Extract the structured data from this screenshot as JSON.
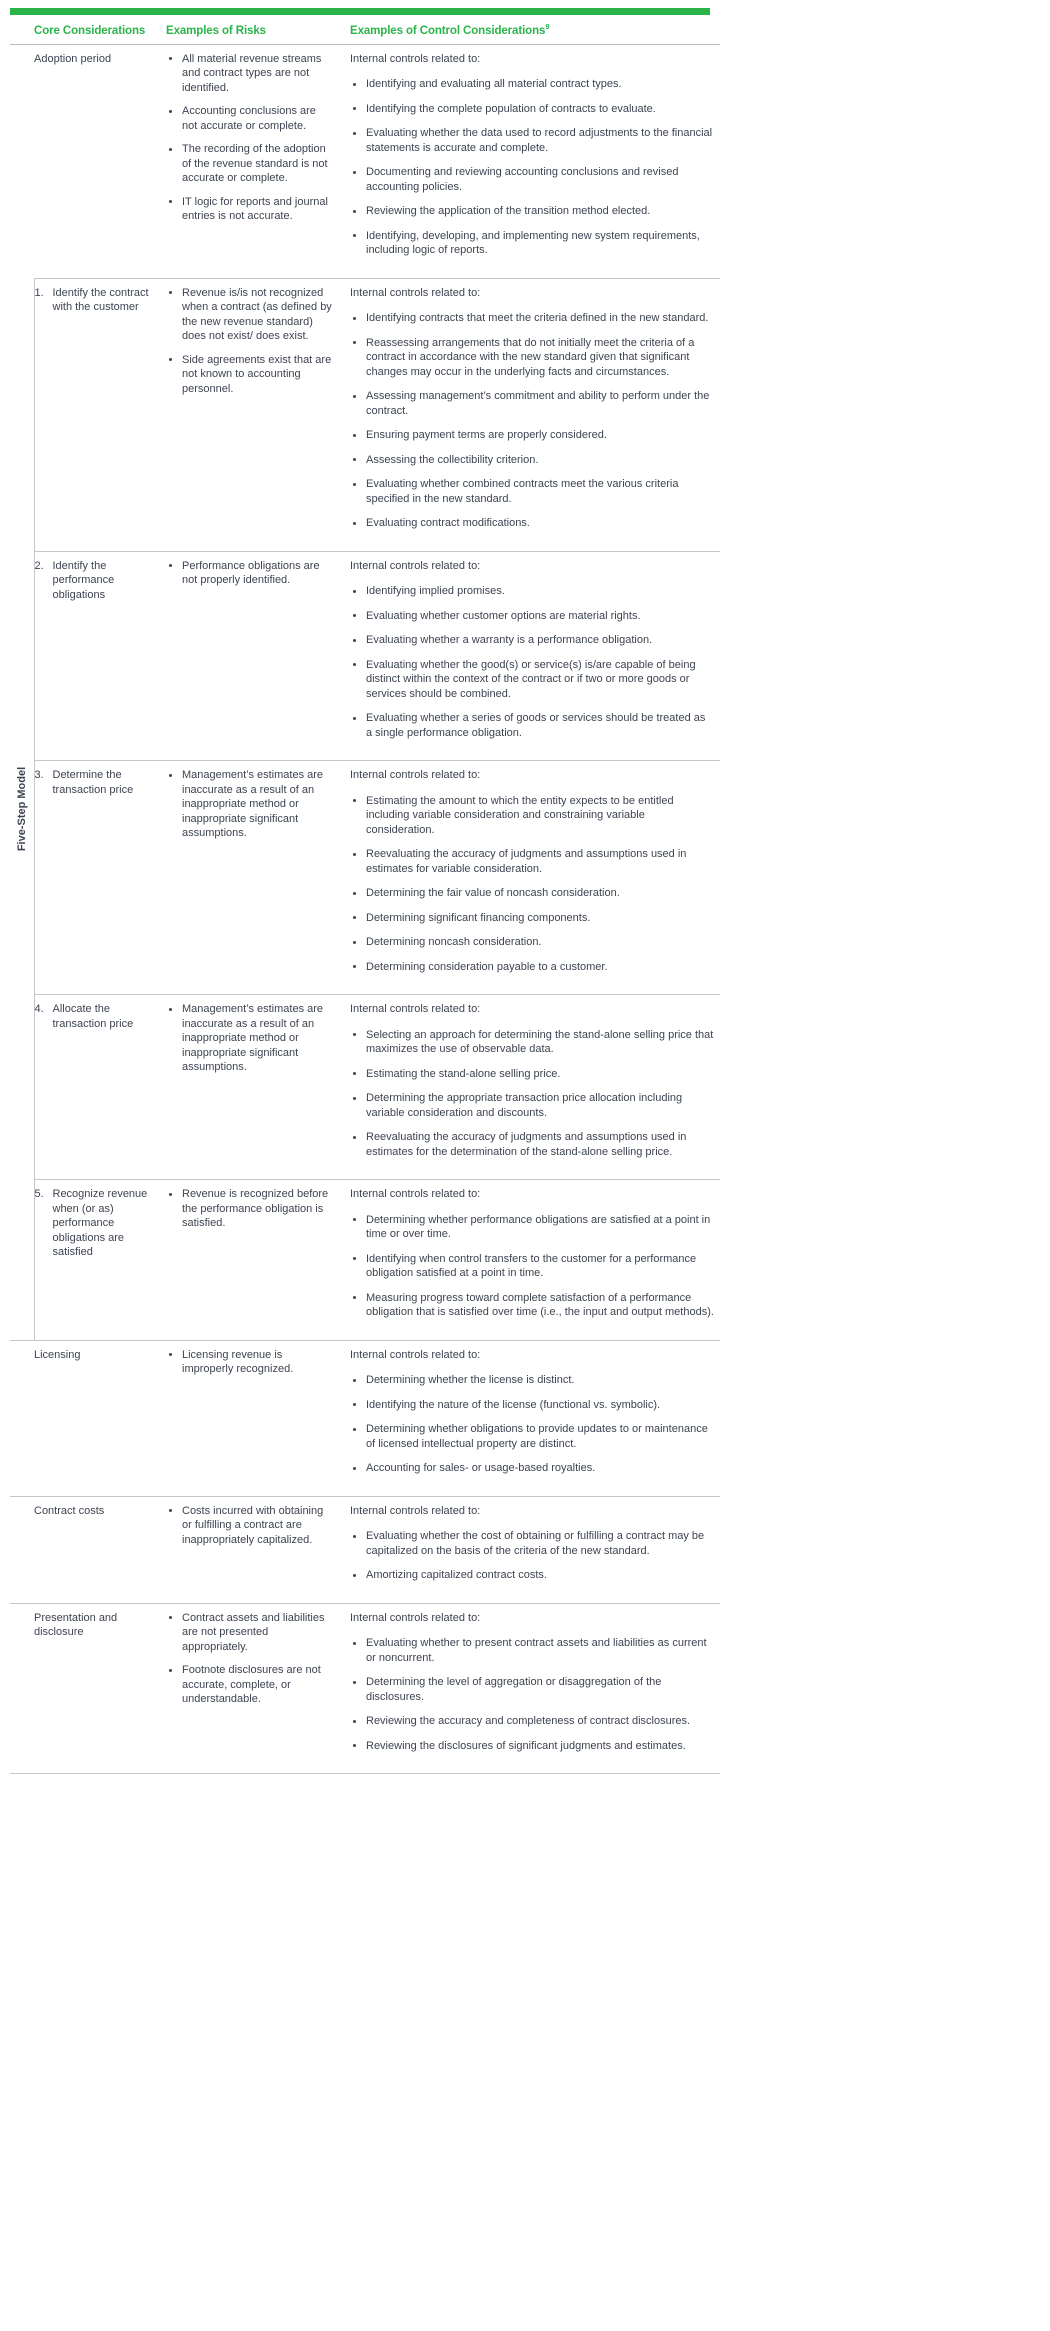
{
  "accent_color": "#2cb34a",
  "text_color": "#3d4451",
  "rule_color": "#c3c6cb",
  "header": {
    "core": "Core Considerations",
    "risks": "Examples of Risks",
    "controls": "Examples of Control Considerations",
    "controls_footnote": "9"
  },
  "side_label": "Five-Step Model",
  "lead_text": "Internal controls related to:",
  "rows": [
    {
      "core": "Adoption period",
      "number": "",
      "risks": [
        "All material revenue streams and contract types are not identified.",
        "Accounting conclusions are not accurate or complete.",
        "The recording of the adoption of the revenue standard is not accurate or complete.",
        "IT logic for reports and journal entries is not accurate."
      ],
      "controls_lead": "Internal controls related to:",
      "controls": [
        "Identifying and evaluating all material contract types.",
        "Identifying the complete population of contracts to evaluate.",
        "Evaluating whether the data used to record adjustments to the financial statements is accurate and complete.",
        "Documenting and reviewing accounting conclusions and revised accounting policies.",
        "Reviewing the application of the transition method elected.",
        "Identifying, developing, and implementing new system requirements, including logic of reports."
      ]
    },
    {
      "core": "Identify the contract with the customer",
      "number": "1.",
      "in_group": true,
      "risks": [
        "Revenue is/is not recognized when a contract (as defined by the new revenue standard) does not exist/ does exist.",
        "Side agreements exist that are not known to accounting personnel."
      ],
      "controls_lead": "Internal controls related to:",
      "controls": [
        "Identifying contracts that meet the criteria defined in the new standard.",
        "Reassessing arrangements that do not initially meet the criteria of a contract in accordance with the new standard given that significant changes may occur in the underlying facts and circumstances.",
        "Assessing management’s commitment and ability to perform under the contract.",
        "Ensuring payment terms are properly considered.",
        "Assessing the collectibility criterion.",
        "Evaluating whether combined contracts meet the various criteria specified in the new standard.",
        "Evaluating contract modifications."
      ]
    },
    {
      "core": "Identify the performance obligations",
      "number": "2.",
      "in_group": true,
      "risks": [
        "Performance obligations are not properly identified."
      ],
      "controls_lead": "Internal controls related to:",
      "controls": [
        "Identifying implied promises.",
        "Evaluating whether customer options are material rights.",
        "Evaluating whether a warranty is a performance obligation.",
        "Evaluating whether the good(s) or service(s) is/are capable of being distinct within the context of the contract or if two or more goods or services should be combined.",
        "Evaluating whether a series of goods or services should be treated as a single performance obligation."
      ]
    },
    {
      "core": "Determine the transaction price",
      "number": "3.",
      "in_group": true,
      "risks": [
        "Management’s estimates are inaccurate as a result of an inappropriate method or inappropriate significant assumptions."
      ],
      "controls_lead": "Internal controls related to:",
      "controls": [
        "Estimating the amount to which the entity expects to be entitled including variable consideration and constraining variable consideration.",
        "Reevaluating the accuracy of judgments and assumptions used in estimates for variable consideration.",
        "Determining the fair value of noncash consideration.",
        "Determining significant financing components.",
        "Determining noncash consideration.",
        "Determining consideration payable to a customer."
      ]
    },
    {
      "core": "Allocate the transaction price",
      "number": "4.",
      "in_group": true,
      "risks": [
        "Management’s estimates are inaccurate as a result of an inappropriate method or inappropriate significant assumptions."
      ],
      "controls_lead": "Internal controls related to:",
      "controls": [
        "Selecting an approach for determining the stand-alone selling price that maximizes the use of observable data.",
        "Estimating the stand-alone selling price.",
        "Determining the appropriate transaction price allocation including variable consideration and discounts.",
        "Reevaluating the accuracy of judgments and assumptions used in estimates for the determination of the stand-alone selling price."
      ]
    },
    {
      "core": "Recognize revenue when (or as) performance obligations are satisfied",
      "number": "5.",
      "in_group": true,
      "risks": [
        "Revenue is recognized before the performance obligation is satisfied."
      ],
      "controls_lead": "Internal controls related to:",
      "controls": [
        "Determining whether performance obligations are satisfied at a point in time or over time.",
        "Identifying when control transfers to the customer for a performance obligation satisfied at a point in time.",
        "Measuring progress toward complete satisfaction of a performance obligation that is satisfied over time (i.e., the input and output methods)."
      ]
    },
    {
      "core": "Licensing",
      "number": "",
      "risks": [
        "Licensing revenue is improperly recognized."
      ],
      "controls_lead": "Internal controls related to:",
      "controls": [
        "Determining whether the license is distinct.",
        "Identifying the nature of the license (functional vs. symbolic).",
        "Determining whether obligations to provide updates to or maintenance of licensed intellectual property are distinct.",
        "Accounting for sales- or usage-based royalties."
      ]
    },
    {
      "core": "Contract costs",
      "number": "",
      "risks": [
        "Costs incurred with obtaining or fulfilling a contract are inappropriately capitalized."
      ],
      "controls_lead": "Internal controls related to:",
      "controls": [
        "Evaluating whether the cost of obtaining or fulfilling a contract may be capitalized on the basis of the criteria of the new standard.",
        "Amortizing capitalized contract costs."
      ]
    },
    {
      "core": "Presentation and disclosure",
      "number": "",
      "risks": [
        "Contract assets and liabilities are not presented appropriately.",
        "Footnote disclosures are not accurate, complete, or understandable."
      ],
      "controls_lead": "Internal controls related to:",
      "controls": [
        "Evaluating whether to present contract assets and liabilities as current or noncurrent.",
        "Determining the level of aggregation or disaggregation of the disclosures.",
        "Reviewing the accuracy and completeness of contract disclosures.",
        "Reviewing the disclosures of significant judgments and estimates."
      ]
    }
  ]
}
